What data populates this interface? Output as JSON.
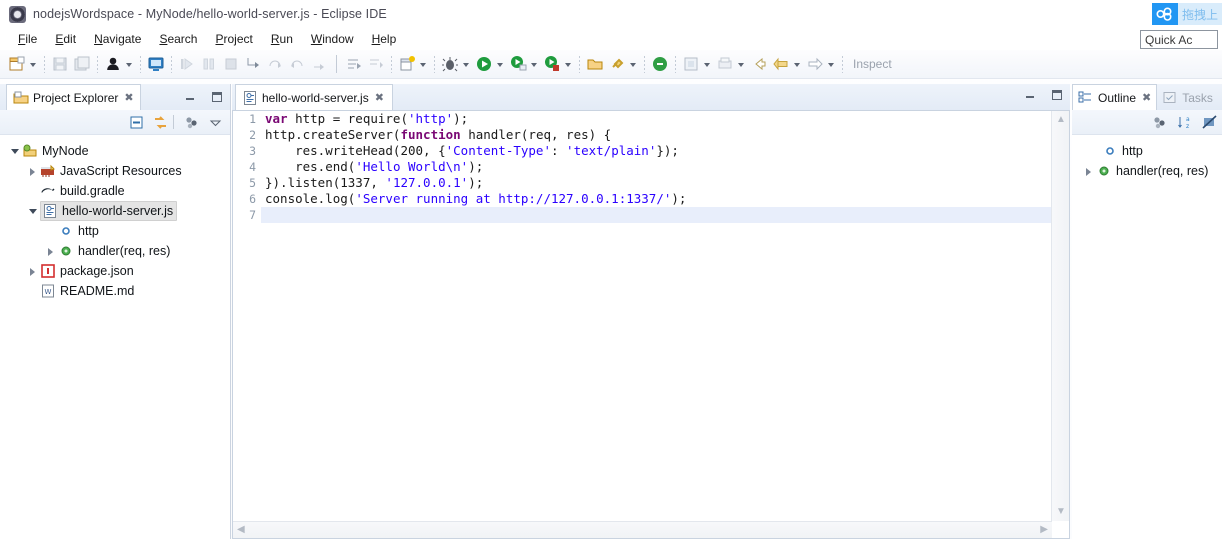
{
  "window": {
    "title": "nodejsWordspace - MyNode/hello-world-server.js - Eclipse IDE",
    "app_icon": "eclipse-icon"
  },
  "menubar": {
    "items": [
      {
        "label": "File"
      },
      {
        "label": "Edit"
      },
      {
        "label": "Navigate"
      },
      {
        "label": "Search"
      },
      {
        "label": "Project"
      },
      {
        "label": "Run"
      },
      {
        "label": "Window"
      },
      {
        "label": "Help"
      }
    ]
  },
  "toolbar": {
    "inspect_label": "Inspect",
    "quick_access": {
      "value": "",
      "placeholder": "Quick Access"
    },
    "cloud_badge": {
      "label": "拖拽上",
      "icon": "baidu-cloud-icon",
      "color": "#2196f3"
    }
  },
  "project_explorer": {
    "tab_label": "Project Explorer",
    "tree": [
      {
        "label": "MyNode",
        "icon": "project-icon",
        "depth": 0,
        "expanded": true,
        "arrow": "open"
      },
      {
        "label": "JavaScript Resources",
        "icon": "js-library-icon",
        "depth": 1,
        "arrow": "closed"
      },
      {
        "label": "build.gradle",
        "icon": "gradle-icon",
        "depth": 1,
        "arrow": "none"
      },
      {
        "label": "hello-world-server.js",
        "icon": "js-file-icon",
        "depth": 1,
        "arrow": "open",
        "selected": true
      },
      {
        "label": "http",
        "icon": "variable-icon",
        "depth": 2,
        "arrow": "none"
      },
      {
        "label": "handler(req, res)",
        "icon": "function-icon",
        "depth": 2,
        "arrow": "closed"
      },
      {
        "label": "package.json",
        "icon": "json-file-icon",
        "depth": 1,
        "arrow": "closed"
      },
      {
        "label": "README.md",
        "icon": "markdown-file-icon",
        "depth": 1,
        "arrow": "none"
      }
    ]
  },
  "editor": {
    "tab_label": "hello-world-server.js",
    "tab_icon": "js-file-icon",
    "current_line": 7,
    "lines": [
      {
        "n": "1",
        "tokens": [
          {
            "t": "var",
            "c": "kw"
          },
          {
            "t": " http = require(",
            "c": ""
          },
          {
            "t": "'http'",
            "c": "str"
          },
          {
            "t": ");",
            "c": ""
          }
        ]
      },
      {
        "n": "2",
        "tokens": [
          {
            "t": "http.createServer(",
            "c": ""
          },
          {
            "t": "function",
            "c": "kw"
          },
          {
            "t": " handler(req, res) {",
            "c": ""
          }
        ]
      },
      {
        "n": "3",
        "tokens": [
          {
            "t": "    res.writeHead(200, {",
            "c": ""
          },
          {
            "t": "'Content-Type'",
            "c": "str"
          },
          {
            "t": ": ",
            "c": ""
          },
          {
            "t": "'text/plain'",
            "c": "str"
          },
          {
            "t": "});",
            "c": ""
          }
        ]
      },
      {
        "n": "4",
        "tokens": [
          {
            "t": "    res.end(",
            "c": ""
          },
          {
            "t": "'Hello World\\n'",
            "c": "str"
          },
          {
            "t": ");",
            "c": ""
          }
        ]
      },
      {
        "n": "5",
        "tokens": [
          {
            "t": "}).listen(1337, ",
            "c": ""
          },
          {
            "t": "'127.0.0.1'",
            "c": "str"
          },
          {
            "t": ");",
            "c": ""
          }
        ]
      },
      {
        "n": "6",
        "tokens": [
          {
            "t": "console.log(",
            "c": ""
          },
          {
            "t": "'Server running at http://127.0.0.1:1337/'",
            "c": "str"
          },
          {
            "t": ");",
            "c": ""
          }
        ]
      },
      {
        "n": "7",
        "tokens": [
          {
            "t": "",
            "c": ""
          }
        ]
      }
    ]
  },
  "right_panel": {
    "tabs": [
      {
        "label": "Outline",
        "icon": "outline-icon",
        "active": true
      },
      {
        "label": "Tasks",
        "icon": "tasks-icon",
        "active": false
      }
    ],
    "outline": [
      {
        "label": "http",
        "icon": "variable-icon",
        "arrow": "none"
      },
      {
        "label": "handler(req, res)",
        "icon": "function-icon",
        "arrow": "closed"
      }
    ]
  }
}
